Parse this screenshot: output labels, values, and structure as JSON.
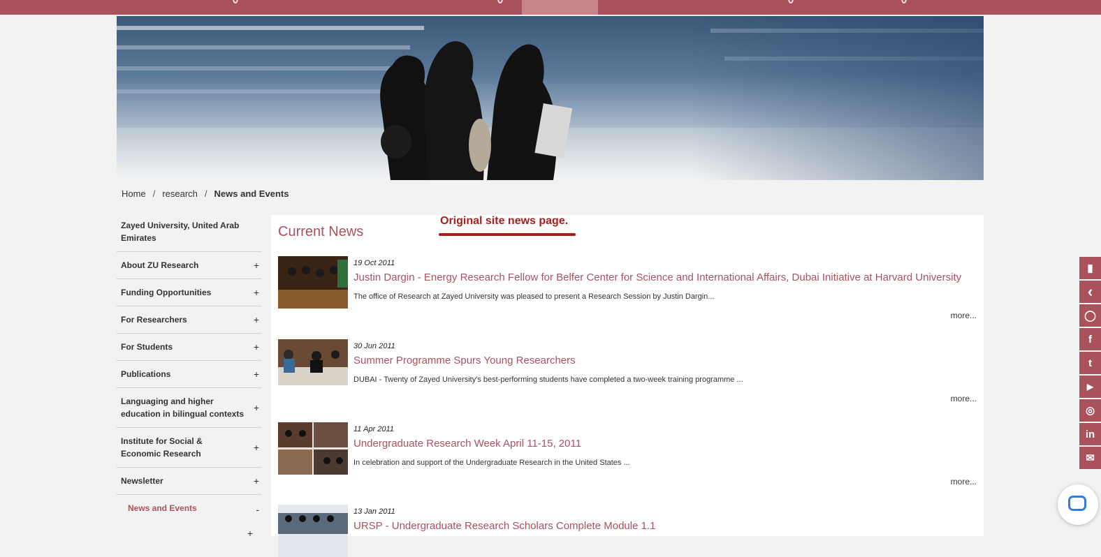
{
  "breadcrumb": {
    "home": "Home",
    "research": "research",
    "current": "News and Events"
  },
  "sidebar": {
    "items": [
      {
        "label": "Zayed University, United Arab Emirates",
        "expand": ""
      },
      {
        "label": "About ZU Research",
        "expand": "+"
      },
      {
        "label": "Funding Opportunities",
        "expand": "+"
      },
      {
        "label": "For Researchers",
        "expand": "+"
      },
      {
        "label": "For Students",
        "expand": "+"
      },
      {
        "label": "Publications",
        "expand": "+"
      },
      {
        "label": "Languaging and higher education in bilingual contexts",
        "expand": "+"
      },
      {
        "label": "Institute for Social & Economic Research",
        "expand": "+"
      },
      {
        "label": "Newsletter",
        "expand": "+"
      }
    ],
    "active_sub": {
      "label": "News and Events",
      "expand": "-"
    },
    "trailing_expand": "+"
  },
  "content": {
    "title": "Current News",
    "annotation": "Original site news page.",
    "more_label": "more...",
    "news": [
      {
        "date": "19 Oct 2011",
        "title": "Justin Dargin - Energy Research Fellow for Belfer Center for Science and International Affairs, Dubai Initiative at Harvard University",
        "desc": "The office of Research at Zayed University was pleased to present a Research Session by Justin Dargin..."
      },
      {
        "date": "30 Jun 2011",
        "title": "Summer Programme Spurs Young Researchers",
        "desc": "DUBAI - Twenty of Zayed University's best-performing students have completed a two-week training programme ..."
      },
      {
        "date": "11 Apr 2011",
        "title": "Undergraduate Research Week April 11-15, 2011",
        "desc": "In celebration and support of the Undergraduate Research in the United States ..."
      },
      {
        "date": "13 Jan 2011",
        "title": "URSP - Undergraduate Research Scholars Complete Module 1.1",
        "desc": ""
      }
    ]
  },
  "social": {
    "icons": [
      "chart-icon",
      "chevron-left-icon",
      "circle-icon",
      "facebook-icon",
      "twitter-icon",
      "youtube-icon",
      "instagram-icon",
      "linkedin-icon",
      "mail-icon"
    ],
    "glyphs": [
      "▮",
      "‹",
      "◯",
      "f",
      "t",
      "▶",
      "◎",
      "in",
      "✉"
    ]
  },
  "colors": {
    "brand": "#a9525c",
    "annotation": "#a81f1f",
    "chat": "#2f7fd8"
  }
}
